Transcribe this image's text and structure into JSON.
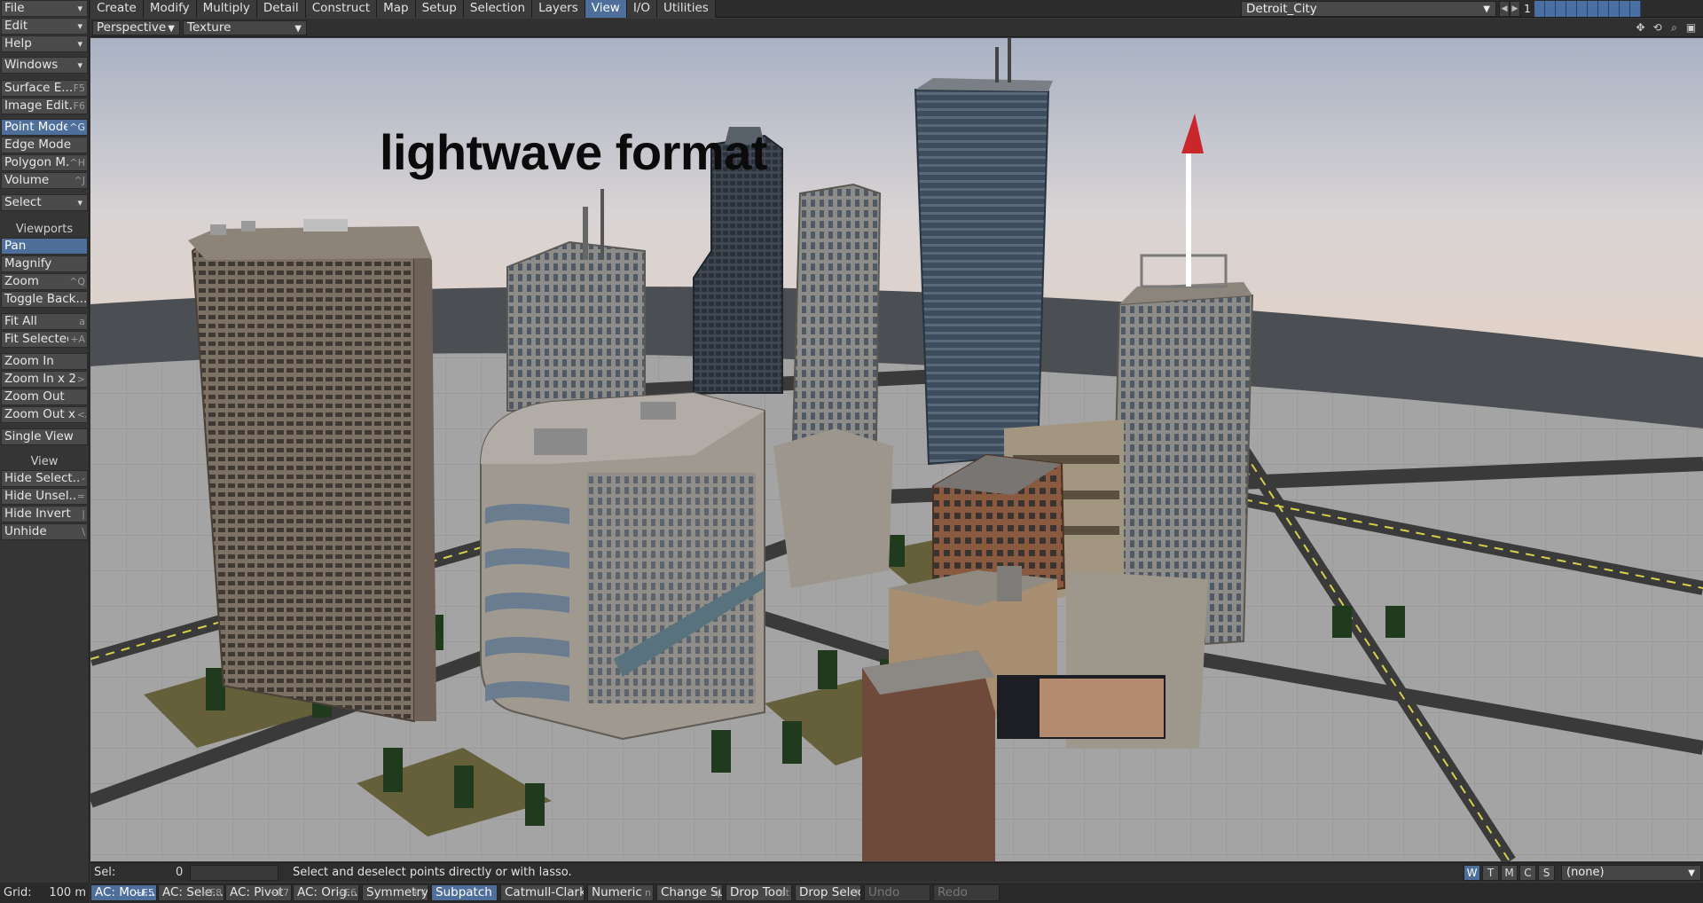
{
  "menu_tabs": [
    "Create",
    "Modify",
    "Multiply",
    "Detail",
    "Construct",
    "Map",
    "Setup",
    "Selection",
    "Layers",
    "View",
    "I/O",
    "Utilities"
  ],
  "active_tab": "View",
  "scene": "Detroit_City",
  "frame": "1",
  "sidebar": {
    "file": "File",
    "edit": "Edit",
    "help": "Help",
    "windows": "Windows",
    "surface_editor": {
      "label": "Surface E...",
      "shortcut": "F5"
    },
    "image_editor": {
      "label": "Image Edit...",
      "shortcut": "F6"
    },
    "point_mode": {
      "label": "Point Mode",
      "shortcut": "^G"
    },
    "edge_mode": {
      "label": "Edge Mode",
      "shortcut": ""
    },
    "polygon_mode": {
      "label": "Polygon M...",
      "shortcut": "^H"
    },
    "volume": {
      "label": "Volume",
      "shortcut": "^J"
    },
    "select": "Select",
    "viewports_heading": "Viewports",
    "pan": {
      "label": "Pan",
      "shortcut": ""
    },
    "magnify": {
      "label": "Magnify",
      "shortcut": ""
    },
    "zoom": {
      "label": "Zoom",
      "shortcut": "^Q"
    },
    "toggle_background": {
      "label": "Toggle Back...",
      "shortcut": ""
    },
    "fit_all": {
      "label": "Fit All",
      "shortcut": "a"
    },
    "fit_selected": {
      "label": "Fit Selected",
      "shortcut": "+A"
    },
    "zoom_in": {
      "label": "Zoom In",
      "shortcut": ""
    },
    "zoom_in_x2": {
      "label": "Zoom In x 2",
      "shortcut": ">"
    },
    "zoom_out": {
      "label": "Zoom Out",
      "shortcut": ""
    },
    "zoom_out_x2": {
      "label": "Zoom Out x...",
      "shortcut": "<"
    },
    "single_view": {
      "label": "Single View",
      "shortcut": ""
    },
    "view_heading": "View",
    "hide_selected": {
      "label": "Hide Select...",
      "shortcut": "-"
    },
    "hide_unselected": {
      "label": "Hide Unsel...",
      "shortcut": "="
    },
    "hide_invert": {
      "label": "Hide Invert",
      "shortcut": "|"
    },
    "unhide": {
      "label": "Unhide",
      "shortcut": "\\"
    }
  },
  "viewport": {
    "view_type": "Perspective",
    "render_style": "Texture",
    "overlay_text": "lightwave format"
  },
  "status": {
    "sel_label": "Sel:",
    "sel_count": "0",
    "hint": "Select and deselect points directly or with lasso.",
    "modes": [
      "W",
      "T",
      "M",
      "C",
      "S"
    ],
    "active_mode": "W",
    "surface_select": "(none)"
  },
  "grid": {
    "label": "Grid:",
    "value": "100 m"
  },
  "toolbar": {
    "ac_mouse": {
      "label": "AC: Mou...",
      "shortcut": "+F5"
    },
    "ac_selection": {
      "label": "AC: Sele...",
      "shortcut": "+F8"
    },
    "ac_pivot": {
      "label": "AC: Pivot",
      "shortcut": "+F7"
    },
    "ac_origin": {
      "label": "AC: Orig...",
      "shortcut": "+F6"
    },
    "symmetry": {
      "label": "Symmetry",
      "shortcut": "+Y"
    },
    "subpatch": {
      "label": "Subpatch",
      "shortcut": ""
    },
    "catmull_clark": {
      "label": "Catmull-Clark",
      "shortcut": ""
    },
    "numeric": {
      "label": "Numeric",
      "shortcut": "n"
    },
    "change_surface": {
      "label": "Change Su...",
      "shortcut": "q"
    },
    "drop_tool": {
      "label": "Drop Tool",
      "shortcut": "ret"
    },
    "drop_selection": {
      "label": "Drop Select...",
      "shortcut": "/"
    },
    "undo": {
      "label": "Undo",
      "shortcut": ""
    },
    "redo": {
      "label": "Redo",
      "shortcut": ""
    }
  },
  "colors": {
    "accent": "#4e6f9a",
    "panel": "#353535",
    "button": "#4b4b4b"
  }
}
